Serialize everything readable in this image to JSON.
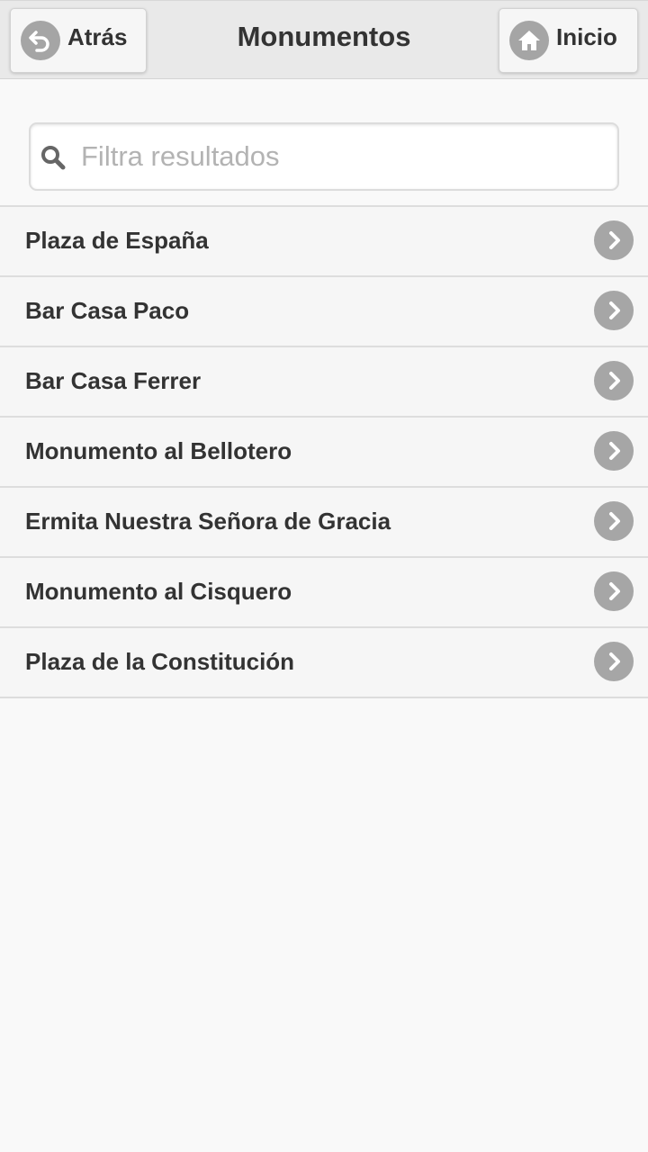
{
  "header": {
    "title": "Monumentos",
    "back_label": "Atrás",
    "home_label": "Inicio",
    "back_icon": "undo-arrow-icon",
    "home_icon": "home-icon"
  },
  "search": {
    "placeholder": "Filtra resultados",
    "value": "",
    "icon": "search-icon"
  },
  "list": {
    "items": [
      {
        "label": "Plaza de España"
      },
      {
        "label": "Bar Casa Paco"
      },
      {
        "label": "Bar Casa Ferrer"
      },
      {
        "label": "Monumento al Bellotero"
      },
      {
        "label": "Ermita Nuestra Señora de Gracia"
      },
      {
        "label": "Monumento al Cisquero"
      },
      {
        "label": "Plaza de la Constitución"
      }
    ],
    "item_icon": "chevron-right-icon"
  },
  "colors": {
    "header_bg": "#e9e9e9",
    "page_bg": "#f9f9f9",
    "icon_gray": "#a6a6a6",
    "text": "#333333"
  }
}
